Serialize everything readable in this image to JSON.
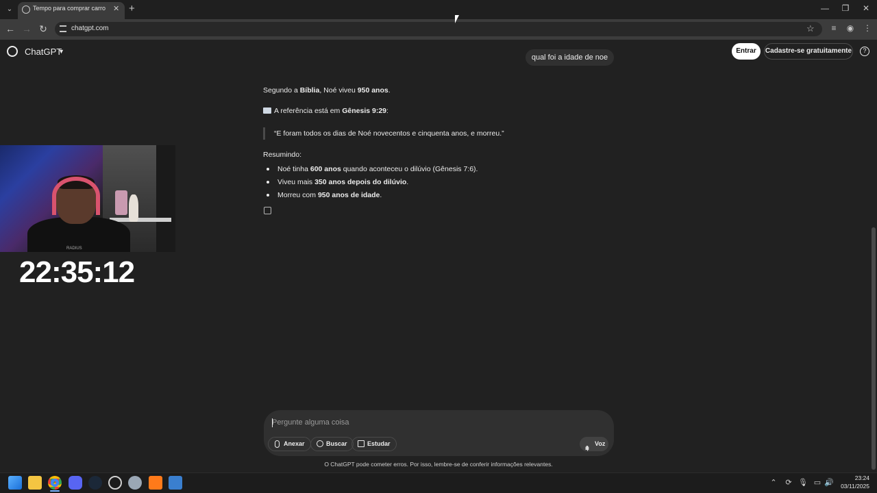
{
  "browser": {
    "tab_title": "Tempo para comprar carro",
    "new_tab": "+",
    "tab_close": "✕",
    "url": "chatgpt.com",
    "window_minimize": "—",
    "window_restore": "❐",
    "window_close": "✕",
    "back": "←",
    "forward": "→",
    "reload": "↻",
    "star": "☆",
    "menu": "⋮"
  },
  "header": {
    "brand": "ChatGPT",
    "login_label": "Entrar",
    "signup_label": "Cadastre-se gratuitamente",
    "help": "?"
  },
  "chat": {
    "user_message": "qual foi a idade de noe",
    "answer": {
      "line1": {
        "a": "Segundo a ",
        "b": "Bíblia",
        "c": ", Noé viveu ",
        "d": "950 anos",
        "e": "."
      },
      "line2": {
        "a": "A referência está em ",
        "b": "Gênesis 9:29",
        "c": ":"
      },
      "quote": "“E foram todos os dias de Noé novecentos e cinquenta anos, e morreu.”",
      "summary_label": "Resumindo:",
      "bullets": [
        {
          "a": "Noé tinha ",
          "b": "600 anos",
          "c": " quando aconteceu o dilúvio (Gênesis 7:6)."
        },
        {
          "a": "Viveu mais ",
          "b": "350 anos depois do dilúvio",
          "c": "."
        },
        {
          "a": "Morreu com ",
          "b": "950 anos de idade",
          "c": "."
        }
      ]
    }
  },
  "overlay": {
    "clock": "22:35:12",
    "shirt_text": "RADIUS"
  },
  "composer": {
    "placeholder": "Pergunte alguma coisa",
    "attach_label": "Anexar",
    "search_label": "Buscar",
    "study_label": "Estudar",
    "voice_label": "Voz",
    "voice_icon": "ıl|ı"
  },
  "disclaimer": "O ChatGPT pode cometer erros. Por isso, lembre-se de conferir informações relevantes.",
  "taskbar": {
    "time": "23:24",
    "date": "03/11/2025",
    "apps": [
      "windows-start",
      "file-explorer",
      "chrome",
      "discord",
      "steam",
      "obs",
      "settings",
      "app-a",
      "calculator"
    ],
    "tray_icons": [
      "chevron-up",
      "sync",
      "microphone",
      "display",
      "volume"
    ]
  },
  "colors": {
    "background": "#212121",
    "composer": "#303030",
    "accent_chrome": "#7ab3ff"
  }
}
